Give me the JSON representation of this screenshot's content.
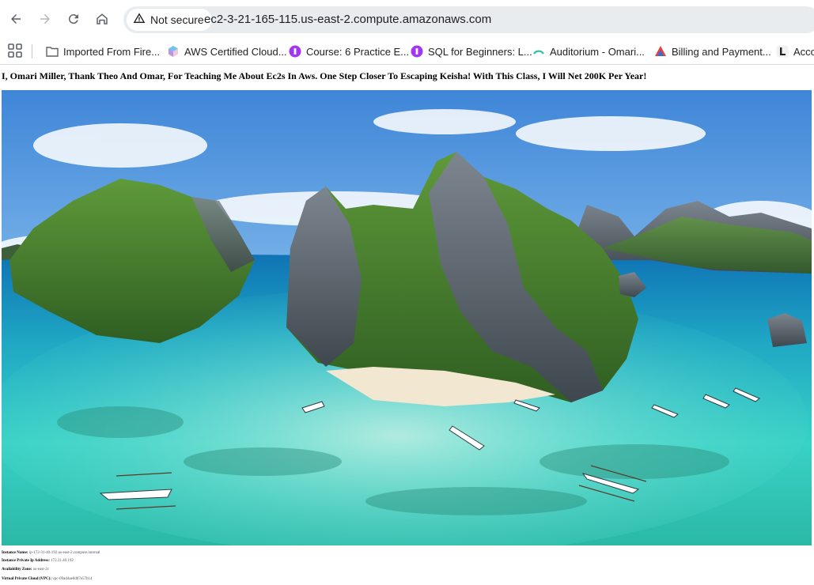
{
  "browser": {
    "security_label": "Not secure",
    "url": "ec2-3-21-165-115.us-east-2.compute.amazonaws.com",
    "nav_icons": [
      "back-arrow-icon",
      "forward-arrow-icon",
      "reload-icon",
      "home-icon"
    ]
  },
  "bookmarks": [
    {
      "label": "Imported From Fire...",
      "icon": "folder-icon"
    },
    {
      "label": "AWS Certified Cloud...",
      "icon": "cube-icon"
    },
    {
      "label": "Course: 6 Practice E...",
      "icon": "purple-circle-icon"
    },
    {
      "label": "SQL for Beginners: L...",
      "icon": "purple-circle-icon"
    },
    {
      "label": "Auditorium - Omari...",
      "icon": "teal-arc-icon"
    },
    {
      "label": "Billing and Payment...",
      "icon": "tricolor-triangle-icon"
    },
    {
      "label": "Acco",
      "icon": "letter-l-icon"
    }
  ],
  "page": {
    "heading": "I, Omari Miller, Thank Theo And Omar, For Teaching Me About Ec2s In Aws. One Step Closer To Escaping Keisha! With This Class, I Will Net 200K Per Year!",
    "metadata": [
      {
        "label": "Instance Name:",
        "value": "ip-172-31-40-192.us-east-2.compute.internal"
      },
      {
        "label": "Instance Private Ip Address:",
        "value": "172.31.40.192"
      },
      {
        "label": "Availability Zone:",
        "value": "us-east-2c"
      },
      {
        "label": "Virtual Private Cloud (VPC):",
        "value": "vpc-09ad4ae0d07e57b14"
      }
    ]
  },
  "colors": {
    "sky_top": "#3f86d8",
    "sky_bottom": "#cfe6f7",
    "sea_shallow": "#38d2c6",
    "sea_deep": "#0f72b5",
    "rock": "#5b6670",
    "foliage": "#3e7a2a",
    "sand": "#f2e8d2"
  }
}
